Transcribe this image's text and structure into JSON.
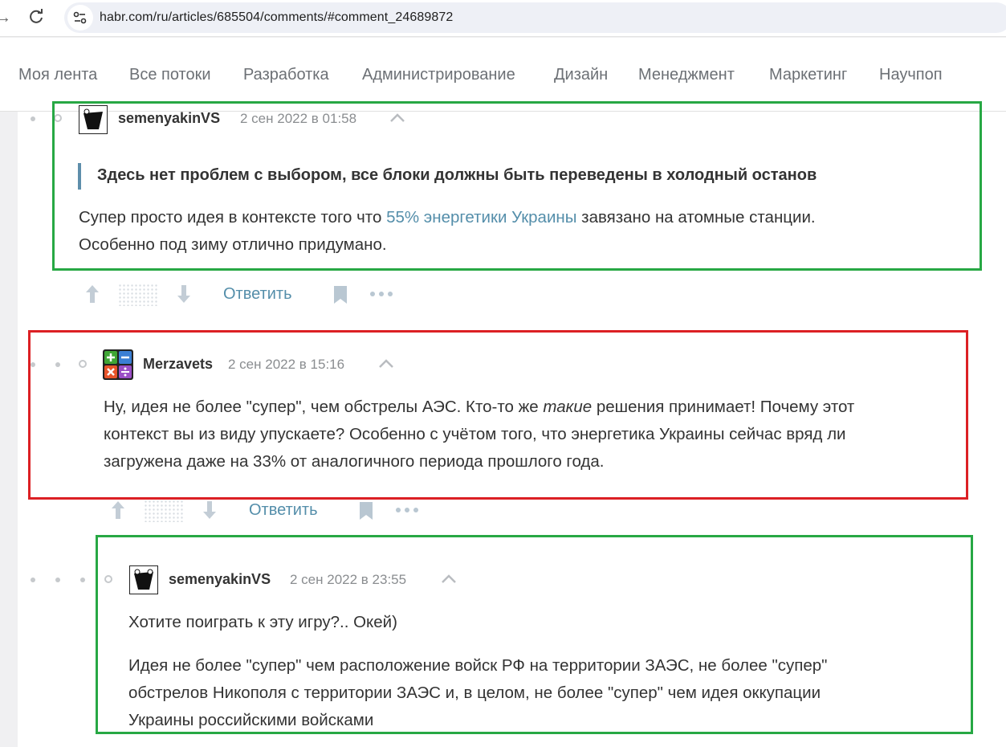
{
  "browser": {
    "url": "habr.com/ru/articles/685504/comments/#comment_24689872"
  },
  "nav": {
    "items": [
      "Моя лента",
      "Все потоки",
      "Разработка",
      "Администрирование",
      "Дизайн",
      "Менеджмент",
      "Маркетинг",
      "Научпоп"
    ]
  },
  "comments": [
    {
      "author": "semenyakinVS",
      "date": "2 сен 2022 в 01:58",
      "quote": "Здесь нет проблем с выбором, все блоки должны быть переведены в холодный останов",
      "text_before": "Супер просто идея в контексте того что ",
      "link": "55% энергетики Украины",
      "text_after": " завязано на атомные станции.",
      "text_line2": "Особенно под зиму отлично придумано.",
      "reply_label": "Ответить"
    },
    {
      "author": "Merzavets",
      "date": "2 сен 2022 в 15:16",
      "line1_a": "Ну, идея не более \"супер\", чем обстрелы АЭС. Кто-то же ",
      "line1_em": "такие",
      "line1_b": " решения принимает! Почему этот",
      "line2": "контекст вы из виду упускаете? Особенно с учётом того, что энергетика Украины сейчас вряд ли",
      "line3": "загружена даже на 33% от аналогичного периода прошлого года.",
      "reply_label": "Ответить"
    },
    {
      "author": "semenyakinVS",
      "date": "2 сен 2022 в 23:55",
      "para1": "Хотите поиграть к эту игру?.. Окей)",
      "line1": "Идея не более \"супер\" чем расположение войск РФ на территории ЗАЭС, не более \"супер\"",
      "line2": "обстрелов Никополя с территории ЗАЭС и, в целом, не более \"супер\" чем идея оккупации",
      "line3": "Украины российскими войсками"
    }
  ],
  "colors": {
    "link": "#548eaa",
    "highlight_green": "#27a844",
    "highlight_red": "#dc2024"
  }
}
